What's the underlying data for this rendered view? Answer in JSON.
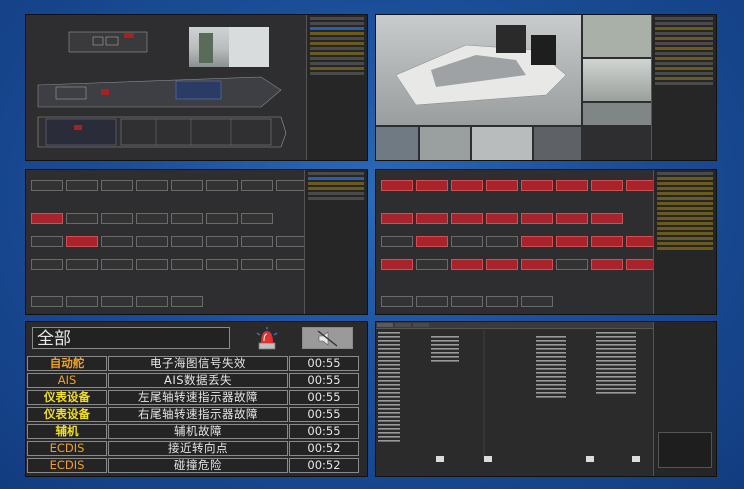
{
  "alarm_panel": {
    "filter_value": "全部",
    "alarms": [
      {
        "source": "自动舵",
        "message": "电子海图信号失效",
        "time": "00:55",
        "color": "#f0a020"
      },
      {
        "source": "AIS",
        "message": "AIS数据丢失",
        "time": "00:55",
        "color": "#f0a020"
      },
      {
        "source": "仪表设备",
        "message": "左尾轴转速指示器故障",
        "time": "00:55",
        "color": "#f2e020"
      },
      {
        "source": "仪表设备",
        "message": "右尾轴转速指示器故障",
        "time": "00:55",
        "color": "#f2e020"
      },
      {
        "source": "辅机",
        "message": "辅机故障",
        "time": "00:55",
        "color": "#f2e020"
      },
      {
        "source": "ECDIS",
        "message": "接近转向点",
        "time": "00:52",
        "color": "#f0a020"
      },
      {
        "source": "ECDIS",
        "message": "碰撞危险",
        "time": "00:52",
        "color": "#f0a020"
      }
    ],
    "icons": [
      "alarm-beacon-icon",
      "speaker-muted-icon"
    ]
  },
  "colors": {
    "background": "#1b4f9a",
    "panel": "#2e2e30",
    "alarm_red": "#a8232b",
    "selection_blue": "#2a5db0"
  }
}
